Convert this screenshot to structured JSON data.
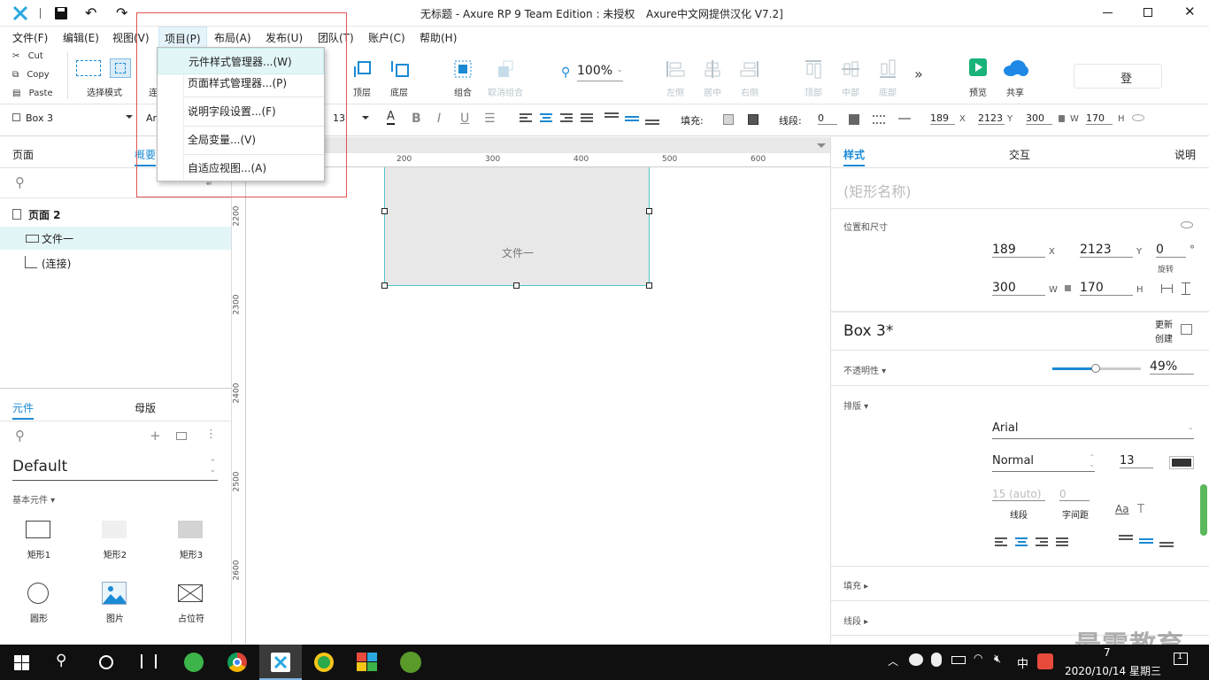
{
  "window": {
    "title": "无标题 - Axure RP 9 Team Edition : 未授权",
    "subtitle": "Axure中文网提供汉化 V7.2]"
  },
  "menubar": [
    "文件(F)",
    "编辑(E)",
    "视图(V)",
    "项目(P)",
    "布局(A)",
    "发布(U)",
    "团队(T)",
    "账户(C)",
    "帮助(H)"
  ],
  "dropdown": {
    "items": [
      "元件样式管理器...(W)",
      "页面样式管理器...(P)",
      "说明字段设置...(F)",
      "全局变量...(V)",
      "自适应视图...(A)"
    ]
  },
  "clipboard": {
    "cut": "Cut",
    "copy": "Copy",
    "paste": "Paste"
  },
  "toolbar": {
    "select_mode": "选择模式",
    "connect": "连",
    "top": "顶层",
    "bottom": "底层",
    "group": "组合",
    "ungroup": "取消组合",
    "zoom": "100%",
    "left": "左侧",
    "center": "居中",
    "right": "右侧",
    "align_top": "顶部",
    "middle": "中部",
    "align_bottom": "底部",
    "preview": "预览",
    "share": "共享",
    "login": "登"
  },
  "format": {
    "style_name": "Box 3",
    "font_partial": "Ar",
    "font_size": "13",
    "fill_label": "填充:",
    "stroke_label": "线段:",
    "stroke_width": "0",
    "x": "189",
    "y": "2123",
    "w": "300",
    "h": "170",
    "x_unit": "X",
    "y_unit": "Y",
    "w_unit": "W",
    "h_unit": "H"
  },
  "left": {
    "tabs": [
      "页面",
      "概要"
    ],
    "page": "页面 2",
    "items": [
      "文件一",
      "(连接)"
    ],
    "lib_tabs": [
      "元件",
      "母版"
    ],
    "library": "Default",
    "category": "基本元件 ▾",
    "widgets": [
      "矩形1",
      "矩形2",
      "矩形3",
      "圆形",
      "图片",
      "占位符"
    ]
  },
  "canvas": {
    "ruler_x": [
      "200",
      "300",
      "400",
      "500",
      "600"
    ],
    "ruler_y": [
      "2200",
      "2300",
      "2400",
      "2500",
      "2600"
    ],
    "box_text": "文件一"
  },
  "right": {
    "tabs": [
      "样式",
      "交互",
      "说明"
    ],
    "name_placeholder": "(矩形名称)",
    "pos_section": "位置和尺寸",
    "x": "189",
    "y": "2123",
    "rotation": "0",
    "rotation_label": "旋转",
    "deg": "°",
    "w": "300",
    "h": "170",
    "style_name": "Box 3*",
    "update": "更新",
    "create": "创建",
    "opacity_label": "不透明性 ▾",
    "opacity": "49%",
    "opacity_level": 0.49,
    "typography_label": "排版 ▾",
    "font": "Arial",
    "weight": "Normal",
    "size": "13",
    "line_spacing": "15 (auto)",
    "char_spacing": "0",
    "line_spacing_label": "线段",
    "char_spacing_label": "字间距",
    "fill_label": "填充 ▸",
    "stroke_label": "线段 ▸"
  },
  "taskbar": {
    "ime": "中",
    "datetime": "2020/10/14 星期三",
    "time_partial": "7",
    "notif": "1"
  },
  "watermark": "最需教育",
  "colors": {
    "accent": "#1a8ad4",
    "logo": "#2aa8e0",
    "preview": "#19b37a",
    "share": "#1e88e5",
    "selection": "#4ec7c7"
  }
}
